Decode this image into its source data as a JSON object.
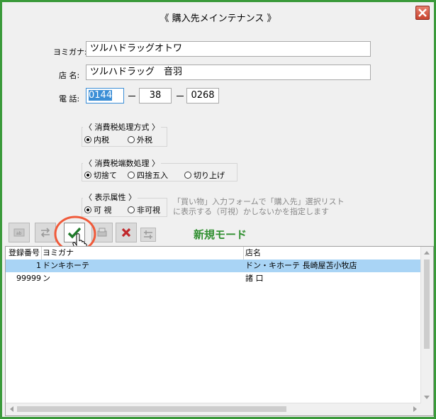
{
  "window": {
    "title": "《 購入先メインテナンス 》"
  },
  "form": {
    "yomigana_label": "ヨミガナ:",
    "yomigana_value": "ツルハドラッグオトワ",
    "name_label": "店  名:",
    "name_value": "ツルハドラッグ　音羽",
    "phone_label": "電  話:",
    "phone_1": "0144",
    "phone_2": "38",
    "phone_3": "0268"
  },
  "tax_method": {
    "title": "〈 消費税処理方式 〉",
    "options": [
      "内税",
      "外税"
    ],
    "selected": 0
  },
  "tax_rounding": {
    "title": "〈 消費税端数処理 〉",
    "options": [
      "切捨て",
      "四捨五入",
      "切り上げ"
    ],
    "selected": 0
  },
  "display": {
    "title": "〈 表示属性 〉",
    "options": [
      "可  視",
      "非可視"
    ],
    "selected": 0,
    "hint_line1": "「買い物」入力フォームで「購入先」選択リスト",
    "hint_line2": "に表示する（可視）かしないかを指定します"
  },
  "toolbar": {
    "mode_label": "新規モード"
  },
  "grid": {
    "headers": [
      "登録番号",
      "ヨミガナ",
      "店名"
    ],
    "rows": [
      {
        "id": "1",
        "kana": "ドンキホーテ",
        "name": "ドン・キホーテ 長崎屋苫小牧店",
        "selected": true
      },
      {
        "id": "99999",
        "kana": "ン",
        "name": "諸  口",
        "selected": false
      }
    ]
  },
  "colors": {
    "border": "#3a9a3a",
    "selection": "#a9d4f5",
    "mode": "#2f8f2f"
  }
}
